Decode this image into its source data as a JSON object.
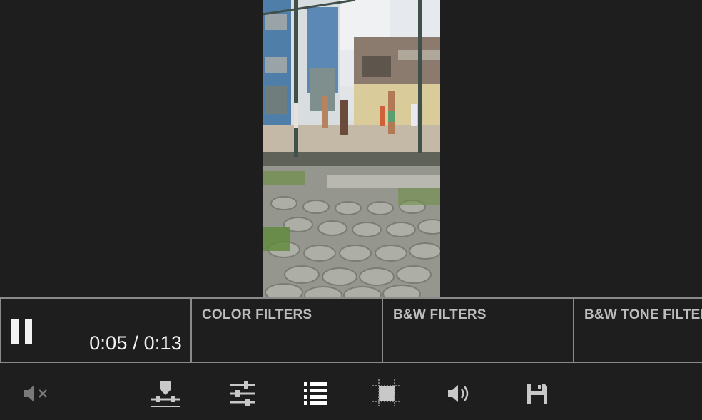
{
  "player": {
    "time_display": "0:05 / 0:13",
    "state": "playing",
    "pause_icon": "pause-icon"
  },
  "filters": [
    {
      "label": "COLOR FILTERS"
    },
    {
      "label": "B&W FILTERS"
    },
    {
      "label": "B&W TONE FILTERS"
    }
  ],
  "toolbar": {
    "items": [
      {
        "icon": "mute-icon"
      },
      {
        "icon": "trim-icon"
      },
      {
        "icon": "adjustments-icon"
      },
      {
        "icon": "list-icon"
      },
      {
        "icon": "crop-icon"
      },
      {
        "icon": "volume-icon"
      },
      {
        "icon": "save-icon"
      }
    ]
  },
  "colors": {
    "background": "#1e1e1e",
    "border": "#8a8a8a",
    "text": "#f2f2f2",
    "label": "#bdbdbd"
  }
}
